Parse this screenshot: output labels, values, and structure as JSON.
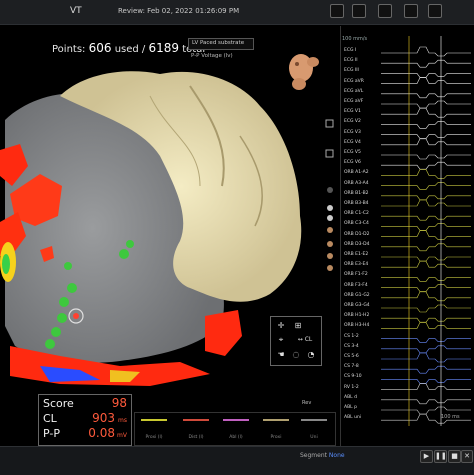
{
  "topbar": {
    "title": "VT",
    "review": "Review: Feb 02, 2022 01:26:09 PM"
  },
  "map": {
    "points_label": "Points:",
    "points_used": "606",
    "used_label": "used /",
    "points_total": "6189",
    "total_label": "total",
    "map_select": "LV Paced substrate",
    "map_sub": "P-P Voltage (lv)"
  },
  "ecg": {
    "header_speed": "100 mm/s",
    "leads": [
      "ECG I",
      "ECG II",
      "ECG III",
      "ECG aVR",
      "ECG aVL",
      "ECG aVF",
      "ECG V1",
      "ECG V2",
      "ECG V3",
      "ECG V4",
      "ECG V5",
      "ECG V6",
      "ORB A1-A2",
      "ORB A3-A4",
      "ORB B1-B2",
      "ORB B3-B4",
      "ORB C1-C2",
      "ORB C3-C4",
      "ORB D1-D2",
      "ORB D3-D4",
      "ORB E1-E2",
      "ORB E3-E4",
      "ORB F1-F2",
      "ORB F3-F4",
      "ORB G1-G2",
      "ORB G3-G4",
      "ORB H1-H2",
      "ORB H3-H4",
      "CS 1-2",
      "CS 3-4",
      "CS 5-6",
      "CS 7-8",
      "CS 9-10",
      "RV 1-2",
      "ABL d",
      "ABL p",
      "ABL uni"
    ],
    "scale_label": "100 ms"
  },
  "scores": {
    "score_label": "Score",
    "score_value": "98",
    "cl_label": "CL",
    "cl_value": "903",
    "cl_unit": "ms",
    "pp_label": "P-P",
    "pp_value": "0.08",
    "pp_unit": "mV"
  },
  "legend": {
    "items": [
      "Proxi (l)",
      "Dist (l)",
      "Abl (l)",
      "Proxi",
      "Uni"
    ],
    "rev_label": "Rev"
  },
  "statusbar": {
    "segment_label": "Segment",
    "segment_value": "None"
  },
  "colors": {
    "score_value": "#ff5a3c",
    "scar": "#808284",
    "healthy": "#e8dfae",
    "low_voltage": "#ff2a10"
  },
  "icons": [
    "window-icon",
    "window-icon",
    "settings-icon",
    "window-icon",
    "play-icon",
    "pause-icon",
    "close-icon"
  ]
}
